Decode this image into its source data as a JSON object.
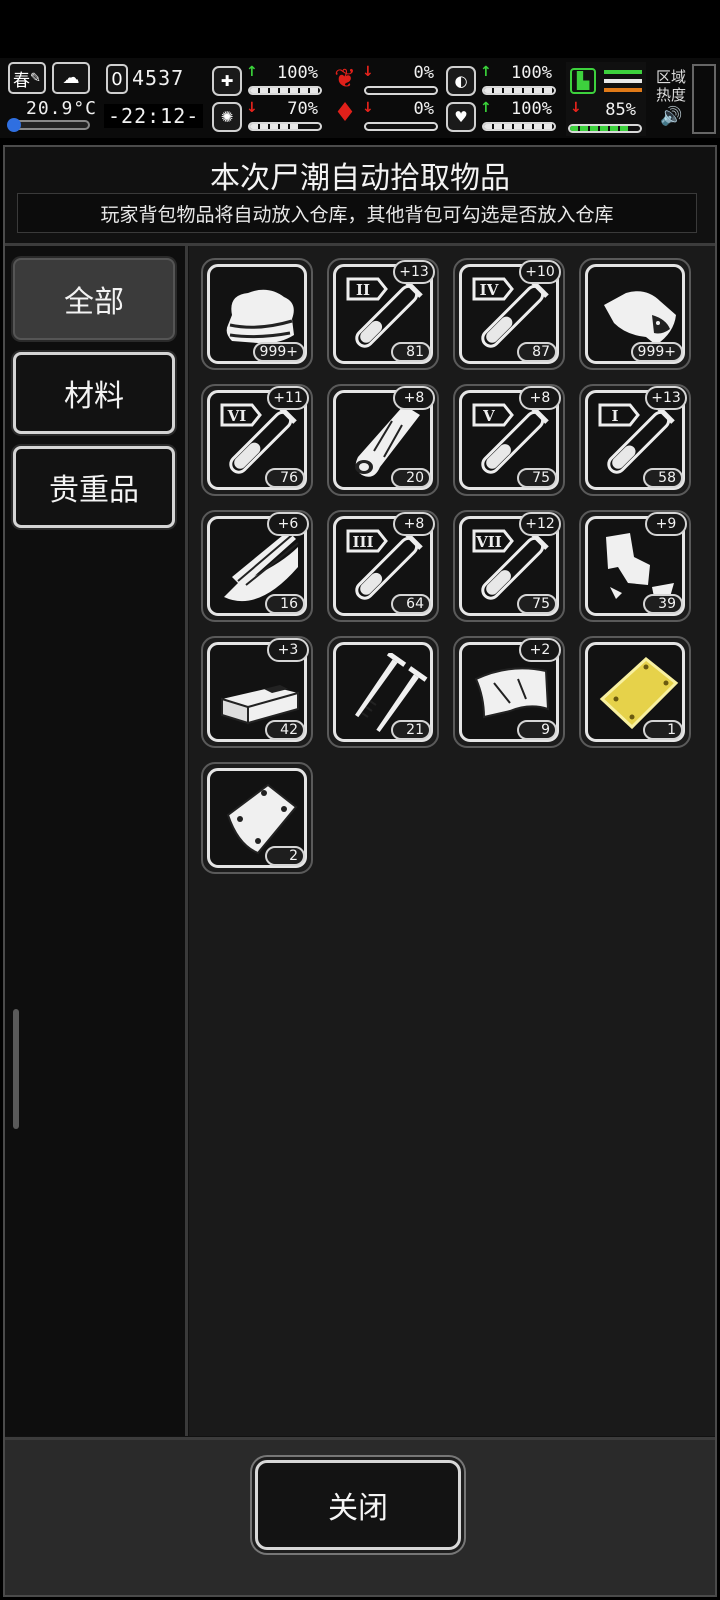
{
  "status": {
    "season": "春",
    "temperature": "20.9°C",
    "counter": "4537",
    "counter_prefix": "0",
    "time": "-22:12-",
    "zone_label": "区域热度",
    "stats": [
      {
        "name": "health",
        "icon": "medkit-icon",
        "trend": "up",
        "value": "100%",
        "level": 1.0
      },
      {
        "name": "hunger",
        "icon": "stomach-icon",
        "trend": "down",
        "value": "0%",
        "level": 0.0
      },
      {
        "name": "medicine",
        "icon": "pill-icon",
        "trend": "up",
        "value": "100%",
        "level": 1.0
      },
      {
        "name": "sanity",
        "icon": "brain-icon",
        "trend": "down",
        "value": "70%",
        "level": 0.7
      },
      {
        "name": "thirst",
        "icon": "blood-drop-icon",
        "trend": "down",
        "value": "0%",
        "level": 0.0
      },
      {
        "name": "mood",
        "icon": "heart-icon",
        "trend": "up",
        "value": "100%",
        "level": 1.0
      },
      {
        "name": "stamina",
        "icon": "boot-icon",
        "trend": "down",
        "value": "85%",
        "level": 0.85
      }
    ]
  },
  "panel": {
    "title": "本次尸潮自动拾取物品",
    "subtitle": "玩家背包物品将自动放入仓库，其他背包可勾选是否放入仓库"
  },
  "tabs": [
    {
      "label": "全部",
      "active": true
    },
    {
      "label": "材料",
      "active": false
    },
    {
      "label": "贵重品",
      "active": false
    }
  ],
  "items": [
    {
      "name": "cloth",
      "qty": "999+",
      "plus": ""
    },
    {
      "name": "test-tube-II",
      "qty": "81",
      "plus": "+13",
      "tag": "II"
    },
    {
      "name": "test-tube-IV",
      "qty": "87",
      "plus": "+10",
      "tag": "IV"
    },
    {
      "name": "meat",
      "qty": "999+",
      "plus": ""
    },
    {
      "name": "test-tube-VI",
      "qty": "76",
      "plus": "+11",
      "tag": "VI"
    },
    {
      "name": "wood-log",
      "qty": "20",
      "plus": "+8"
    },
    {
      "name": "test-tube-V",
      "qty": "75",
      "plus": "+8",
      "tag": "V"
    },
    {
      "name": "test-tube-I",
      "qty": "58",
      "plus": "+13",
      "tag": "I"
    },
    {
      "name": "wood-planks",
      "qty": "16",
      "plus": "+6"
    },
    {
      "name": "test-tube-III",
      "qty": "64",
      "plus": "+8",
      "tag": "III"
    },
    {
      "name": "test-tube-VII",
      "qty": "75",
      "plus": "+12",
      "tag": "VII"
    },
    {
      "name": "scrap-cloth",
      "qty": "39",
      "plus": "+9"
    },
    {
      "name": "brick",
      "qty": "42",
      "plus": "+3"
    },
    {
      "name": "nails",
      "qty": "21",
      "plus": ""
    },
    {
      "name": "leather",
      "qty": "9",
      "plus": "+2"
    },
    {
      "name": "gold-bar",
      "qty": "1",
      "plus": ""
    },
    {
      "name": "metal-plate",
      "qty": "2",
      "plus": ""
    }
  ],
  "close_label": "关闭",
  "colors": {
    "accent_green": "#3dd13d",
    "accent_red": "#e8231c",
    "gold": "#e6d24a"
  }
}
